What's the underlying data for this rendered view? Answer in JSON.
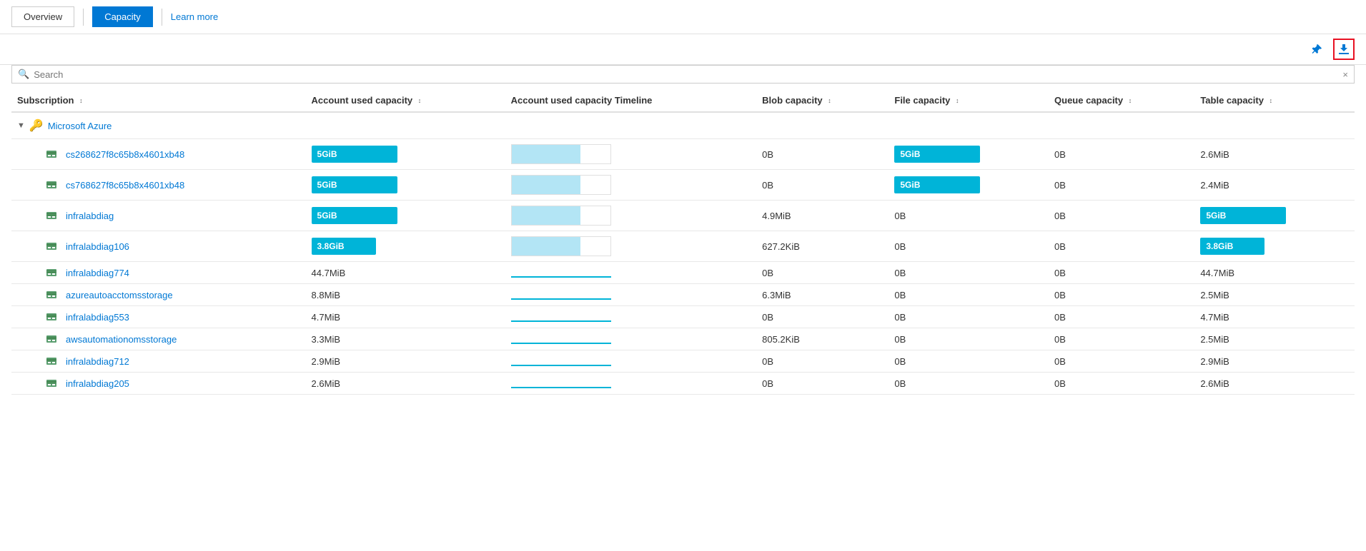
{
  "nav": {
    "overview_label": "Overview",
    "capacity_label": "Capacity",
    "learn_more_label": "Learn more"
  },
  "toolbar": {
    "pin_title": "Pin",
    "download_title": "Download"
  },
  "search": {
    "placeholder": "Search",
    "clear_label": "×"
  },
  "table": {
    "columns": [
      {
        "key": "subscription",
        "label": "Subscription",
        "sortable": true
      },
      {
        "key": "account_used_capacity",
        "label": "Account used capacity",
        "sortable": true
      },
      {
        "key": "account_used_capacity_timeline",
        "label": "Account used capacity Timeline",
        "sortable": false
      },
      {
        "key": "blob_capacity",
        "label": "Blob capacity",
        "sortable": true
      },
      {
        "key": "file_capacity",
        "label": "File capacity",
        "sortable": true
      },
      {
        "key": "queue_capacity",
        "label": "Queue capacity",
        "sortable": true
      },
      {
        "key": "table_capacity",
        "label": "Table capacity",
        "sortable": true
      }
    ],
    "group": {
      "name": "Microsoft Azure",
      "icon": "key-icon"
    },
    "rows": [
      {
        "name": "cs268627f8c65b8x4601xb48",
        "account_used_capacity": "5GiB",
        "account_used_capacity_type": "bar-full",
        "timeline_type": "bar",
        "blob_capacity": "0B",
        "blob_type": "text",
        "file_capacity": "5GiB",
        "file_type": "bar-full",
        "queue_capacity": "0B",
        "queue_type": "text",
        "table_capacity": "2.6MiB",
        "table_type": "text"
      },
      {
        "name": "cs768627f8c65b8x4601xb48",
        "account_used_capacity": "5GiB",
        "account_used_capacity_type": "bar-full",
        "timeline_type": "bar",
        "blob_capacity": "0B",
        "blob_type": "text",
        "file_capacity": "5GiB",
        "file_type": "bar-full",
        "queue_capacity": "0B",
        "queue_type": "text",
        "table_capacity": "2.4MiB",
        "table_type": "text"
      },
      {
        "name": "infralabdiag",
        "account_used_capacity": "5GiB",
        "account_used_capacity_type": "bar-full",
        "timeline_type": "bar",
        "blob_capacity": "4.9MiB",
        "blob_type": "text",
        "file_capacity": "0B",
        "file_type": "text",
        "queue_capacity": "0B",
        "queue_type": "text",
        "table_capacity": "5GiB",
        "table_type": "bar-full"
      },
      {
        "name": "infralabdiag106",
        "account_used_capacity": "3.8GiB",
        "account_used_capacity_type": "bar-partial",
        "timeline_type": "bar",
        "blob_capacity": "627.2KiB",
        "blob_type": "text",
        "file_capacity": "0B",
        "file_type": "text",
        "queue_capacity": "0B",
        "queue_type": "text",
        "table_capacity": "3.8GiB",
        "table_type": "bar-partial"
      },
      {
        "name": "infralabdiag774",
        "account_used_capacity": "44.7MiB",
        "account_used_capacity_type": "text",
        "timeline_type": "line",
        "blob_capacity": "0B",
        "blob_type": "text",
        "file_capacity": "0B",
        "file_type": "text",
        "queue_capacity": "0B",
        "queue_type": "text",
        "table_capacity": "44.7MiB",
        "table_type": "text"
      },
      {
        "name": "azureautoacctomsstorage",
        "account_used_capacity": "8.8MiB",
        "account_used_capacity_type": "text",
        "timeline_type": "line",
        "blob_capacity": "6.3MiB",
        "blob_type": "text",
        "file_capacity": "0B",
        "file_type": "text",
        "queue_capacity": "0B",
        "queue_type": "text",
        "table_capacity": "2.5MiB",
        "table_type": "text"
      },
      {
        "name": "infralabdiag553",
        "account_used_capacity": "4.7MiB",
        "account_used_capacity_type": "text",
        "timeline_type": "line",
        "blob_capacity": "0B",
        "blob_type": "text",
        "file_capacity": "0B",
        "file_type": "text",
        "queue_capacity": "0B",
        "queue_type": "text",
        "table_capacity": "4.7MiB",
        "table_type": "text"
      },
      {
        "name": "awsautomationomsstorage",
        "account_used_capacity": "3.3MiB",
        "account_used_capacity_type": "text",
        "timeline_type": "line",
        "blob_capacity": "805.2KiB",
        "blob_type": "text",
        "file_capacity": "0B",
        "file_type": "text",
        "queue_capacity": "0B",
        "queue_type": "text",
        "table_capacity": "2.5MiB",
        "table_type": "text"
      },
      {
        "name": "infralabdiag712",
        "account_used_capacity": "2.9MiB",
        "account_used_capacity_type": "text",
        "timeline_type": "line",
        "blob_capacity": "0B",
        "blob_type": "text",
        "file_capacity": "0B",
        "file_type": "text",
        "queue_capacity": "0B",
        "queue_type": "text",
        "table_capacity": "2.9MiB",
        "table_type": "text"
      },
      {
        "name": "infralabdiag205",
        "account_used_capacity": "2.6MiB",
        "account_used_capacity_type": "text",
        "timeline_type": "line",
        "blob_capacity": "0B",
        "blob_type": "text",
        "file_capacity": "0B",
        "file_type": "text",
        "queue_capacity": "0B",
        "queue_type": "text",
        "table_capacity": "2.6MiB",
        "table_type": "text"
      }
    ]
  },
  "colors": {
    "accent": "#0078d4",
    "bar_blue": "#00b4d8",
    "bar_light": "#b3e5f5",
    "border": "#e0e0e0",
    "active_nav_bg": "#0078d4",
    "download_border": "#e81123"
  }
}
